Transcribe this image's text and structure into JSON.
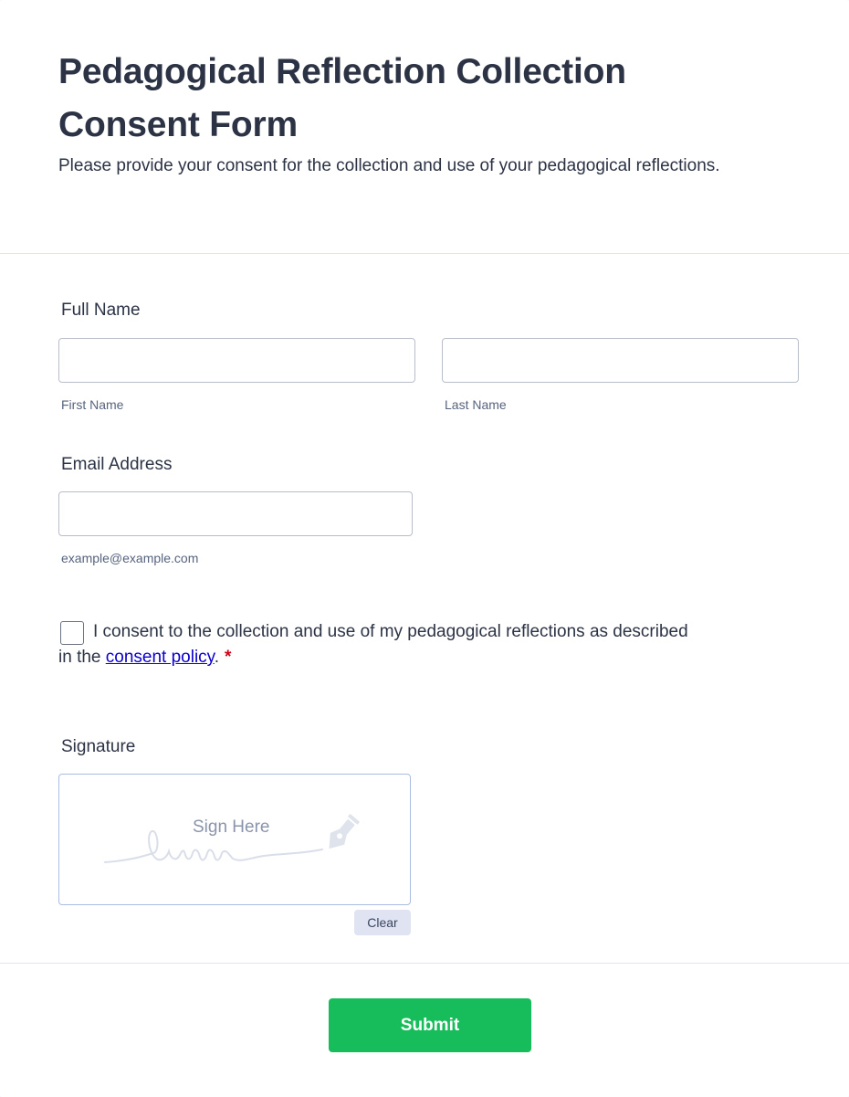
{
  "form": {
    "title": "Pedagogical Reflection Collection Consent Form",
    "subtitle": "Please provide your consent for the collection and use of your pedagogical reflections."
  },
  "full_name": {
    "label": "Full Name",
    "first_value": "",
    "first_sublabel": "First Name",
    "last_value": "",
    "last_sublabel": "Last Name"
  },
  "email": {
    "label": "Email Address",
    "value": "",
    "sublabel": "example@example.com"
  },
  "consent": {
    "text_before": "I consent to the collection and use of my pedagogical reflections as described in the ",
    "link_text": "consent policy",
    "text_after": ".",
    "required_mark": "*",
    "checked": false
  },
  "signature": {
    "label": "Signature",
    "hint": "Sign Here",
    "clear_label": "Clear"
  },
  "footer": {
    "submit_label": "Submit"
  },
  "colors": {
    "submit": "#18bd5b",
    "link": "#0b00cc",
    "required": "#d0021b",
    "text": "#2c3345"
  }
}
